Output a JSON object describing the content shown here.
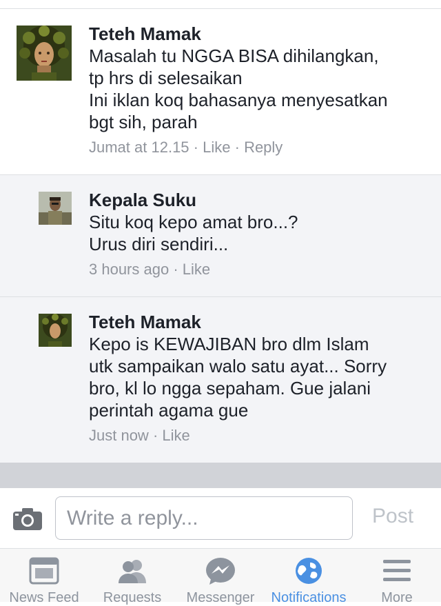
{
  "comments": [
    {
      "author": "Teteh Mamak",
      "lines": [
        "Masalah tu NGGA BISA dihilangkan,",
        "tp hrs di selesaikan",
        "Ini iklan koq bahasanya menyesatkan",
        "bgt sih, parah"
      ],
      "time": "Jumat at 12.15",
      "like": "Like",
      "reply": "Reply"
    },
    {
      "author": "Kepala Suku",
      "lines": [
        "Situ koq kepo amat bro...?",
        "Urus diri sendiri..."
      ],
      "time": "3 hours ago",
      "like": "Like"
    },
    {
      "author": "Teteh Mamak",
      "lines": [
        "Kepo is KEWAJIBAN bro dlm Islam",
        "utk sampaikan walo satu ayat... Sorry",
        "bro, kl lo ngga sepaham. Gue jalani",
        "perintah agama gue"
      ],
      "time": "Just now",
      "like": "Like"
    }
  ],
  "separator": "·",
  "reply_bar": {
    "placeholder": "Write a reply...",
    "post_label": "Post",
    "camera_icon": "camera-icon"
  },
  "tabs": [
    {
      "label": "News Feed",
      "icon": "news-feed-icon",
      "active": false
    },
    {
      "label": "Requests",
      "icon": "requests-icon",
      "active": false
    },
    {
      "label": "Messenger",
      "icon": "messenger-icon",
      "active": false
    },
    {
      "label": "Notifications",
      "icon": "globe-icon",
      "active": true
    },
    {
      "label": "More",
      "icon": "menu-icon",
      "active": false
    }
  ],
  "colors": {
    "accent": "#4a90e2",
    "meta_text": "#90949c",
    "reply_background": "#f3f4f7"
  }
}
